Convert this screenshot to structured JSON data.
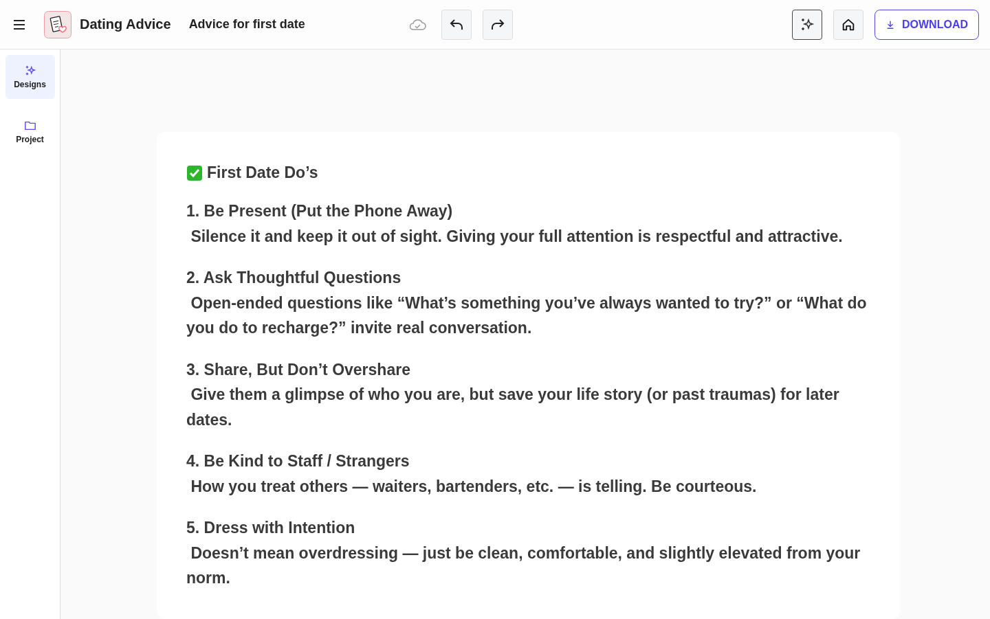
{
  "header": {
    "app_title": "Dating Advice",
    "document_title": "Advice for first date",
    "download_label": "DOWNLOAD"
  },
  "sidebar": {
    "items": [
      {
        "label": "Designs",
        "selected": true
      },
      {
        "label": "Project",
        "selected": false
      }
    ]
  },
  "document": {
    "heading": "First Date Do’s",
    "items": [
      {
        "title": "1. Be Present (Put the Phone Away)",
        "body": " Silence it and keep it out of sight. Giving your full attention is respectful and attractive."
      },
      {
        "title": "2. Ask Thoughtful Questions",
        "body": " Open-ended questions like “What’s something you’ve always wanted to try?” or “What do you do to recharge?” invite real conversation."
      },
      {
        "title": "3. Share, But Don’t Overshare",
        "body": " Give them a glimpse of who you are, but save your life story (or past traumas) for later dates."
      },
      {
        "title": "4. Be Kind to Staff / Strangers",
        "body": " How you treat others — waiters, bartenders, etc. — is telling. Be courteous."
      },
      {
        "title": "5. Dress with Intention",
        "body": " Doesn’t mean overdressing — just be clean, comfortable, and slightly elevated from your norm."
      }
    ]
  }
}
